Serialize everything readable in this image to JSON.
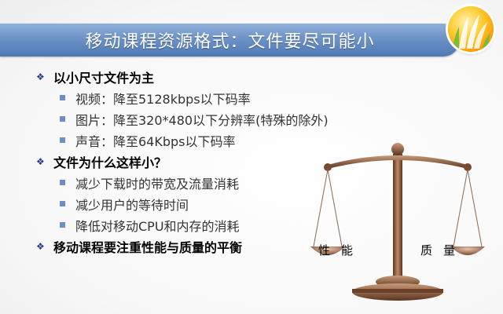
{
  "title": "移动课程资源格式：文件要尽可能小",
  "sections": [
    {
      "heading": "以小尺寸文件为主",
      "items": [
        "视频：降至5128kbps以下码率",
        "图片：降至320*480以下分辨率(特殊的除外)",
        "声音：降至64Kbps以下码率"
      ]
    },
    {
      "heading": "文件为什么这样小？",
      "items": [
        "减少下载时的带宽及流量消耗",
        "减少用户的等待时间",
        "降低对移动CPU和内存的消耗"
      ]
    },
    {
      "heading": "移动课程要注重性能与质量的平衡",
      "items": []
    }
  ],
  "scale": {
    "left_label": "性能",
    "right_label": "质量"
  },
  "icons": [
    "diamond-bullet-icon",
    "square-bullet-icon",
    "balance-scale-icon",
    "logo-icon"
  ],
  "colors": {
    "title_bar": "#6d93c8",
    "bullet_l1": "#2a3c86",
    "bullet_l2": "#6d8fc9",
    "scale_metal": "#8a5a3c"
  }
}
